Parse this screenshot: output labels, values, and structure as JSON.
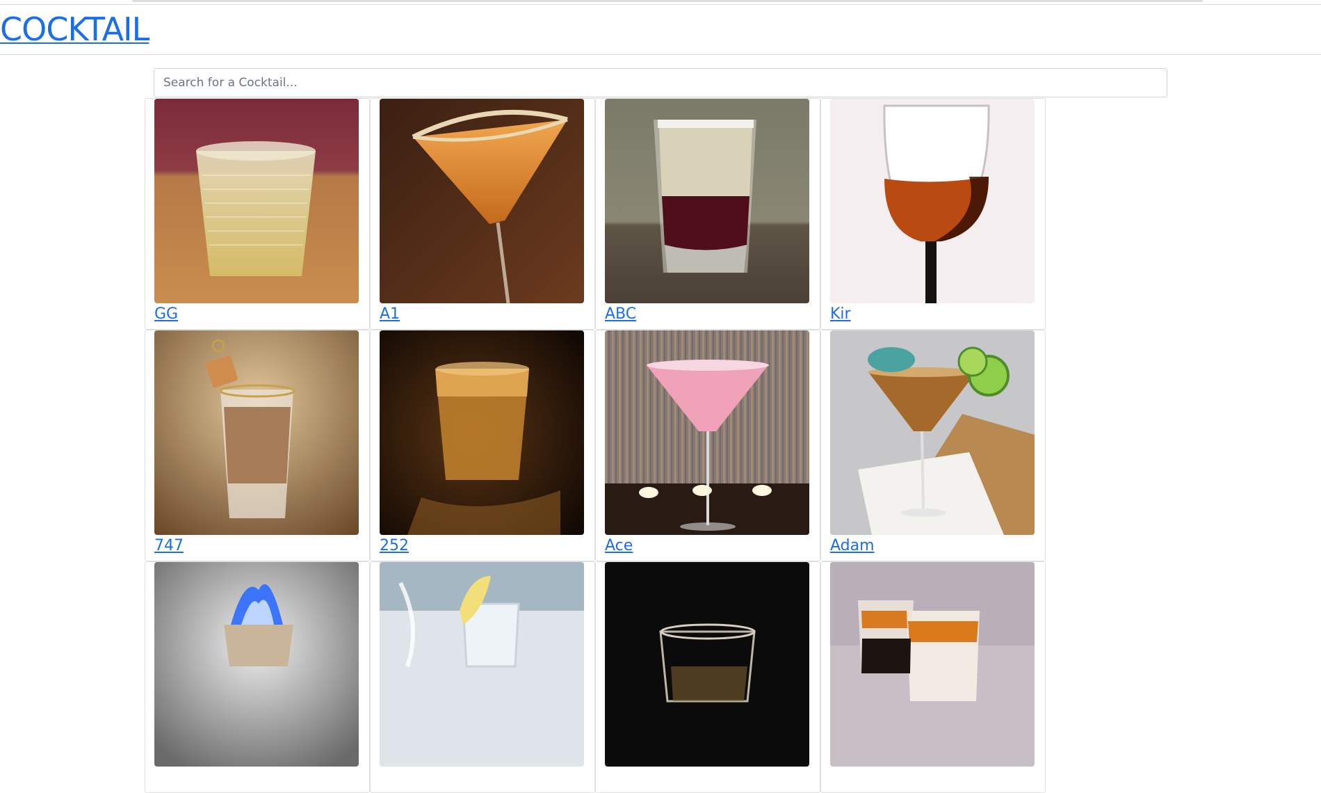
{
  "header": {
    "brand": "COCKTAIL"
  },
  "search": {
    "placeholder": "Search for a Cocktail..."
  },
  "cocktails": [
    {
      "name": "GG"
    },
    {
      "name": "A1"
    },
    {
      "name": "ABC"
    },
    {
      "name": "Kir"
    },
    {
      "name": "747"
    },
    {
      "name": "252"
    },
    {
      "name": "Ace"
    },
    {
      "name": "Adam"
    },
    {
      "name": ""
    },
    {
      "name": ""
    },
    {
      "name": ""
    },
    {
      "name": ""
    }
  ]
}
